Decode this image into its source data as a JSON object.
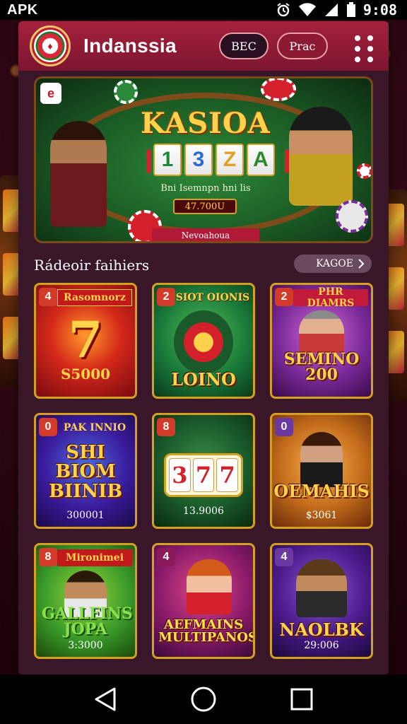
{
  "status_bar": {
    "carrier": "APK",
    "time": "9:08",
    "icons": [
      "alarm-icon",
      "wifi-icon",
      "signal-icon",
      "battery-icon"
    ]
  },
  "header": {
    "title": "Indanssia",
    "btn_left": "BEC",
    "btn_right": "Prac",
    "logo_icon": "casino-chip-logo-icon",
    "menu_icon": "menu-dots-icon"
  },
  "hero": {
    "logo_text": "KASIOA",
    "tiles": [
      "1",
      "3",
      "Z",
      "A"
    ],
    "tile_colors": [
      "#1a8a3a",
      "#2a6ad4",
      "#e0a020",
      "#2a8a2a"
    ],
    "subtitle": "Bni Isemnpn hni lis",
    "amount": "47.700U",
    "cta": "Nevoahoua"
  },
  "section": {
    "title": "Rádeoir faihiers",
    "see_all": "KAGOE"
  },
  "games": [
    {
      "badge": "4",
      "banner": "Rasomnorz",
      "big": "",
      "prize": "S5000"
    },
    {
      "badge": "2",
      "banner": "SIOT OIONIS",
      "big": "LOINO",
      "prize": ""
    },
    {
      "badge": "2",
      "banner": "PHR DIAMRS",
      "big": "SEMINO 200",
      "prize": ""
    },
    {
      "badge": "0",
      "banner": "PAK INNIO",
      "big": "SHI BIOM BIINIB",
      "prize": "300001"
    },
    {
      "badge": "8",
      "banner": "",
      "big": "",
      "prize": "13.9006"
    },
    {
      "badge": "0",
      "banner": "",
      "big": "OEMAHIS",
      "prize": "$3061"
    },
    {
      "badge": "8",
      "banner": "Mironimei",
      "big": "GALLFINS JOPA",
      "prize": "3:3000"
    },
    {
      "badge": "4",
      "banner": "",
      "big": "AEFMAINS MULTIPANOS",
      "prize": ""
    },
    {
      "badge": "4",
      "banner": "",
      "big": "NAOLBK",
      "prize": "29:006"
    }
  ],
  "card5_reels": [
    "3",
    "7",
    "7"
  ],
  "navbar": {
    "icons": [
      "back-icon",
      "home-icon",
      "recents-icon"
    ]
  },
  "colors": {
    "header": "#a5223c",
    "panel": "#3a1629",
    "gold": "#d4a020"
  }
}
